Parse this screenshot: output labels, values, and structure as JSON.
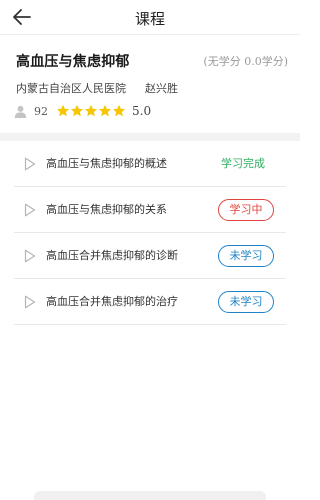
{
  "header": {
    "title": "课程"
  },
  "course": {
    "title": "高血压与焦虑抑郁",
    "credit": "(无学分 0.0学分)",
    "hospital": "内蒙古自治区人民医院",
    "doctor": "赵兴胜",
    "learners": "92",
    "rating_value": "5.0",
    "stars_filled": 5,
    "star_color": "#f6c600"
  },
  "lessons": [
    {
      "title": "高血压与焦虑抑郁的概述",
      "status": "学习完成",
      "status_kind": "done"
    },
    {
      "title": "高血压与焦虑抑郁的关系",
      "status": "学习中",
      "status_kind": "progress"
    },
    {
      "title": "高血压合并焦虑抑郁的诊断",
      "status": "未学习",
      "status_kind": "todo"
    },
    {
      "title": "高血压合并焦虑抑郁的治疗",
      "status": "未学习",
      "status_kind": "todo"
    }
  ],
  "colors": {
    "done": "#2eae5f",
    "progress": "#e0443c",
    "todo": "#1f83c6"
  },
  "icons": {
    "back": "arrow-left-icon",
    "user": "user-icon",
    "star": "star-icon",
    "play": "play-icon"
  }
}
